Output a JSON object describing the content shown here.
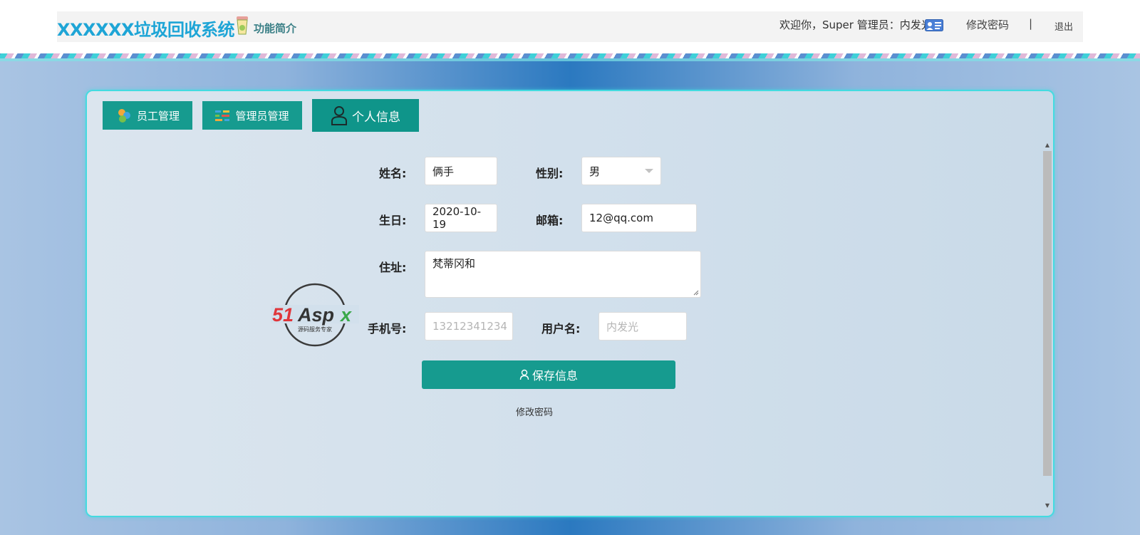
{
  "header": {
    "app_title": "XXXXXX垃圾回收系统",
    "features_link": "功能简介",
    "welcome_text": "欢迎你，Super 管理员：内发光",
    "change_password": "修改密码",
    "separator": "|",
    "logout": "退出"
  },
  "tabs": [
    {
      "label": "员工管理",
      "icon": "people-icon"
    },
    {
      "label": "管理员管理",
      "icon": "admin-icon"
    },
    {
      "label": "个人信息",
      "icon": "user-icon",
      "active": true
    }
  ],
  "form": {
    "name_label": "姓名:",
    "name_value": "俩手",
    "gender_label": "性别:",
    "gender_value": "男",
    "birthday_label": "生日:",
    "birthday_value": "2020-10-19",
    "email_label": "邮箱:",
    "email_value": "12@qq.com",
    "address_label": "住址:",
    "address_value": "梵蒂冈和",
    "phone_label": "手机号:",
    "phone_placeholder": "13212341234",
    "username_label": "用户名:",
    "username_placeholder": "内发光",
    "save_button": "保存信息",
    "change_password_link": "修改密码"
  },
  "watermark": {
    "brand": "51Aspx",
    "tagline": "源码服务专家"
  },
  "colors": {
    "accent": "#169b8f",
    "title": "#1ea5d6",
    "panel_border": "#44dbe0"
  }
}
